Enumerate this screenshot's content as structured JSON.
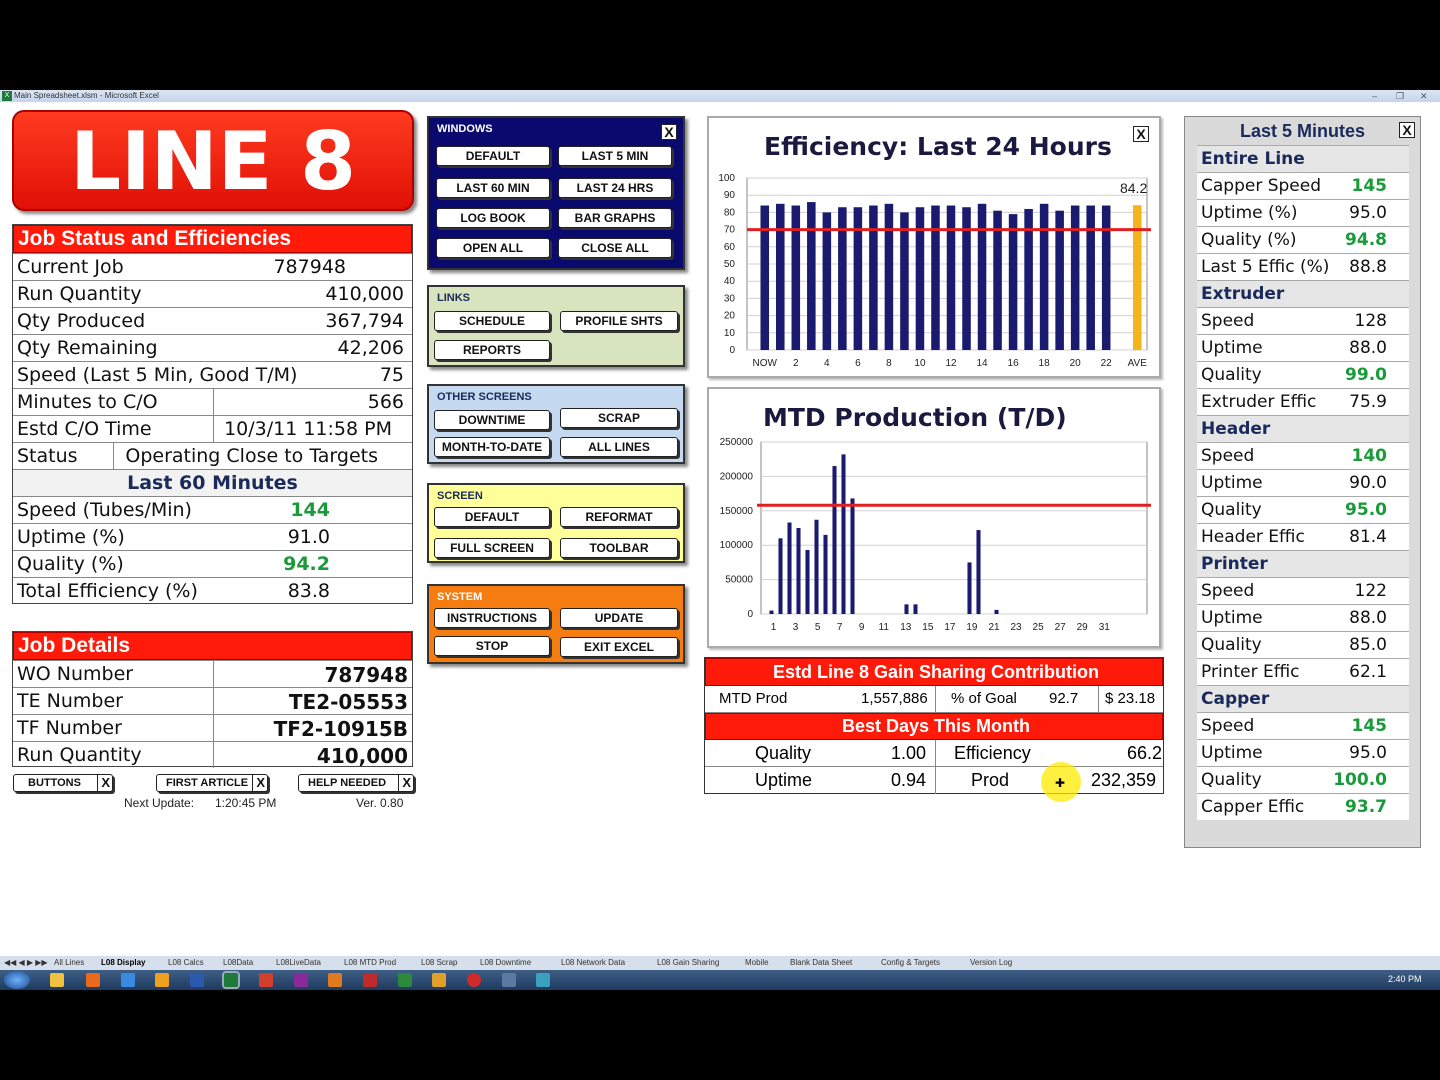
{
  "window": {
    "title": "Main Spreadsheet.xlsm - Microsoft Excel",
    "excel_icon": "X"
  },
  "line_title": "LINE 8",
  "job_status": {
    "header": "Job Status and Efficiencies",
    "rows": [
      {
        "label": "Current Job",
        "value": "787948"
      },
      {
        "label": "Run Quantity",
        "value": "410,000"
      },
      {
        "label": "Qty Produced",
        "value": "367,794"
      },
      {
        "label": "Qty Remaining",
        "value": "42,206"
      },
      {
        "label": "Speed (Last 5 Min, Good T/M)",
        "value": "75"
      },
      {
        "label": "Minutes to C/O",
        "value": "566"
      },
      {
        "label": "Estd C/O Time",
        "value": "10/3/11 11:58 PM"
      },
      {
        "label": "Status",
        "value": "Operating Close to Targets"
      }
    ],
    "last60_header": "Last 60 Minutes",
    "last60": [
      {
        "label": "Speed (Tubes/Min)",
        "value": "144"
      },
      {
        "label": "Uptime (%)",
        "value": "91.0"
      },
      {
        "label": "Quality (%)",
        "value": "94.2"
      },
      {
        "label": "Total Efficiency (%)",
        "value": "83.8"
      }
    ]
  },
  "job_details": {
    "header": "Job Details",
    "rows": [
      {
        "label": "WO Number",
        "value": "787948"
      },
      {
        "label": "TE Number",
        "value": "TE2-05553"
      },
      {
        "label": "TF Number",
        "value": "TF2-10915B"
      },
      {
        "label": "Run Quantity",
        "value": "410,000"
      }
    ]
  },
  "bottom_buttons": {
    "buttons": "BUTTONS",
    "first_article": "FIRST ARTICLE",
    "help_needed": "HELP NEEDED",
    "close": "X"
  },
  "footer": {
    "next_update_label": "Next Update:",
    "next_update_time": "1:20:45 PM",
    "version": "Ver. 0.80"
  },
  "windows_panel": {
    "title": "WINDOWS",
    "close": "X",
    "buttons": [
      "DEFAULT",
      "LAST 5 MIN",
      "LAST 60 MIN",
      "LAST 24 HRS",
      "LOG BOOK",
      "BAR GRAPHS",
      "OPEN ALL",
      "CLOSE ALL"
    ]
  },
  "links_panel": {
    "title": "LINKS",
    "buttons": [
      "SCHEDULE",
      "PROFILE SHTS",
      "REPORTS"
    ]
  },
  "other_panel": {
    "title": "OTHER SCREENS",
    "buttons": [
      "DOWNTIME",
      "SCRAP",
      "MONTH-TO-DATE",
      "ALL LINES"
    ]
  },
  "screen_panel": {
    "title": "SCREEN",
    "buttons": [
      "DEFAULT",
      "REFORMAT",
      "FULL SCREEN",
      "TOOLBAR"
    ]
  },
  "system_panel": {
    "title": "SYSTEM",
    "buttons": [
      "INSTRUCTIONS",
      "UPDATE",
      "STOP",
      "EXIT EXCEL"
    ]
  },
  "chart_data": [
    {
      "type": "bar",
      "title": "Efficiency:  Last 24 Hours",
      "close": "X",
      "ylim": [
        0,
        100
      ],
      "yticks": [
        "0",
        "10",
        "20",
        "30",
        "40",
        "50",
        "60",
        "70",
        "80",
        "90",
        "100"
      ],
      "xticks": [
        "NOW",
        "2",
        "4",
        "6",
        "8",
        "10",
        "12",
        "14",
        "16",
        "18",
        "20",
        "22",
        "AVE"
      ],
      "values": [
        84,
        85,
        84,
        86,
        80,
        83,
        83,
        84,
        85,
        80,
        83,
        84,
        84,
        83,
        85,
        81,
        79,
        82,
        85,
        81,
        84,
        84,
        84
      ],
      "average": 84.2,
      "average_label": "84.2",
      "target": 70,
      "colors": {
        "bar": "#1a1a6e",
        "average": "#f5b41a",
        "target": "#e02020"
      }
    },
    {
      "type": "bar",
      "title": "MTD Production (T/D)",
      "ylim": [
        0,
        250000
      ],
      "yticks": [
        "0",
        "50000",
        "100000",
        "150000",
        "200000",
        "250000"
      ],
      "xticks": [
        "1",
        "3",
        "5",
        "7",
        "9",
        "11",
        "13",
        "15",
        "17",
        "19",
        "21",
        "23",
        "25",
        "27",
        "29",
        "31"
      ],
      "values": [
        5000,
        110000,
        133000,
        125000,
        93000,
        137000,
        115000,
        215000,
        232000,
        168000,
        0,
        0,
        0,
        0,
        0,
        14000,
        14000,
        0,
        0,
        0,
        0,
        0,
        75000,
        122000,
        0,
        6000,
        0,
        0,
        0,
        0,
        0,
        0,
        0,
        0,
        0,
        0,
        0,
        0,
        0,
        0,
        0,
        0
      ],
      "target": 158000,
      "colors": {
        "bar": "#1a1a6e",
        "target": "#e02020"
      }
    }
  ],
  "gain_sharing": {
    "header": "Estd Line 8 Gain Sharing Contribution",
    "mtd_prod_label": "MTD Prod",
    "mtd_prod_value": "1,557,886",
    "goal_label": "% of Goal",
    "goal_value": "92.7",
    "dollars": "$ 23.18"
  },
  "best_days": {
    "header": "Best Days This Month",
    "quality_label": "Quality",
    "quality_value": "1.00",
    "efficiency_label": "Efficiency",
    "efficiency_value": "66.2",
    "uptime_label": "Uptime",
    "uptime_value": "0.94",
    "prod_label": "Prod",
    "prod_value": "232,359"
  },
  "last5": {
    "title": "Last 5 Minutes",
    "close": "X",
    "sections": [
      {
        "name": "Entire Line",
        "rows": [
          {
            "label": "Capper Speed",
            "value": "145",
            "green": true
          },
          {
            "label": "Uptime (%)",
            "value": "95.0",
            "green": false
          },
          {
            "label": "Quality (%)",
            "value": "94.8",
            "green": true
          },
          {
            "label": "Last 5 Effic (%)",
            "value": "88.8",
            "green": false
          }
        ]
      },
      {
        "name": "Extruder",
        "rows": [
          {
            "label": "Speed",
            "value": "128",
            "green": false
          },
          {
            "label": "Uptime",
            "value": "88.0",
            "green": false
          },
          {
            "label": "Quality",
            "value": "99.0",
            "green": true
          },
          {
            "label": "Extruder Effic",
            "value": "75.9",
            "green": false
          }
        ]
      },
      {
        "name": "Header",
        "rows": [
          {
            "label": "Speed",
            "value": "140",
            "green": true
          },
          {
            "label": "Uptime",
            "value": "90.0",
            "green": false
          },
          {
            "label": "Quality",
            "value": "95.0",
            "green": true
          },
          {
            "label": "Header Effic",
            "value": "81.4",
            "green": false
          }
        ]
      },
      {
        "name": "Printer",
        "rows": [
          {
            "label": "Speed",
            "value": "122",
            "green": false
          },
          {
            "label": "Uptime",
            "value": "88.0",
            "green": false
          },
          {
            "label": "Quality",
            "value": "85.0",
            "green": false
          },
          {
            "label": "Printer Effic",
            "value": "62.1",
            "green": false
          }
        ]
      },
      {
        "name": "Capper",
        "rows": [
          {
            "label": "Speed",
            "value": "145",
            "green": true
          },
          {
            "label": "Uptime",
            "value": "95.0",
            "green": false
          },
          {
            "label": "Quality",
            "value": "100.0",
            "green": true
          },
          {
            "label": "Capper Effic",
            "value": "93.7",
            "green": true
          }
        ]
      }
    ]
  },
  "sheet_tabs": [
    "All Lines",
    "L08 Display",
    "L08 Calcs",
    "L08Data",
    "L08LiveData",
    "L08 MTD Prod",
    "L08 Scrap",
    "L08 Downtime",
    "L08 Network Data",
    "L08 Gain Sharing",
    "Mobile",
    "Blank Data Sheet",
    "Config & Targets",
    "Version Log"
  ],
  "clock": "2:40 PM",
  "colors": {
    "red": "#ff1a0a",
    "navy": "#0a0a6e",
    "links_green": "#d7e4bd",
    "other_blue": "#c5d9f1",
    "screen_yellow": "#ffff99",
    "system_orange": "#f57c10"
  }
}
